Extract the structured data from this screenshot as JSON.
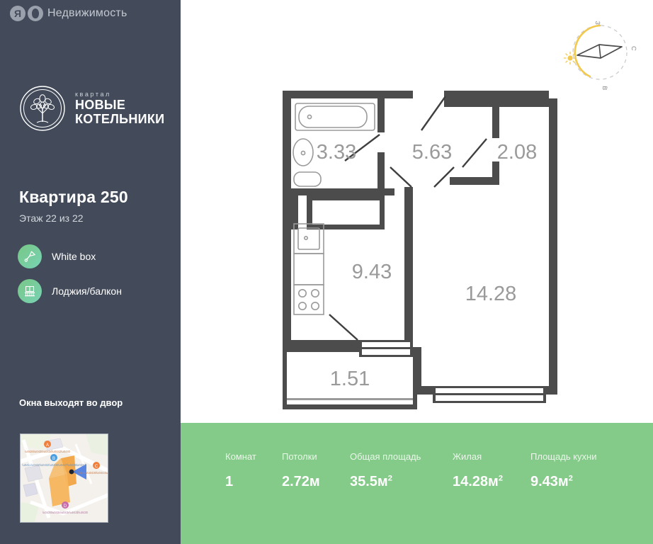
{
  "sidebar": {
    "brand": {
      "logo_letter": "Я",
      "logo_icon": "yandex-circle-icon",
      "text": "Недвижимость"
    },
    "developer": {
      "icon": "tree-emblem-icon",
      "small_line": "квартал",
      "line1": "НОВЫЕ",
      "line2": "КОТЕЛЬНИКИ"
    },
    "apartment": {
      "title": "Квартира 250",
      "floor": "Этаж 22 из 22"
    },
    "features": [
      {
        "icon": "paint-trowel-icon",
        "label": "White box"
      },
      {
        "icon": "balcony-icon",
        "label": "Лоджия/балкон"
      }
    ],
    "windows_note": "Окна выходят во двор",
    "map": {
      "icon": "map-thumbnail",
      "alt": "Карта расположения"
    },
    "colors": {
      "background": "#434b5a",
      "accent_green_start": "#77c785",
      "accent_green_end": "#79d3b5"
    }
  },
  "compass": {
    "icon": "compass-rose-icon",
    "sun_icon": "sun-icon",
    "labels": {
      "west": "З",
      "south": "С",
      "east": "В"
    },
    "arc_color": "#f2c94c"
  },
  "floorplan": {
    "icon": "floor-plan",
    "wall_color": "#4c4c4c",
    "label_color": "#9a9a9a",
    "rooms": [
      {
        "name": "bathroom",
        "area": "3.33"
      },
      {
        "name": "hallway",
        "area": "5.63"
      },
      {
        "name": "storage",
        "area": "2.08"
      },
      {
        "name": "kitchen",
        "area": "9.43"
      },
      {
        "name": "living-room",
        "area": "14.28"
      },
      {
        "name": "balcony",
        "area": "1.51"
      }
    ],
    "fixtures": [
      "bathtub-icon",
      "sink-icon",
      "toilet-icon",
      "kitchen-sink-icon",
      "stove-icon",
      "window-icon"
    ]
  },
  "stats": {
    "background": "#84ca88",
    "items": [
      {
        "label": "Комнат",
        "value": "1",
        "unit": ""
      },
      {
        "label": "Потолки",
        "value": "2.72м",
        "unit": ""
      },
      {
        "label": "Общая площадь",
        "value": "35.5м",
        "unit": "2"
      },
      {
        "label": "Жилая",
        "value": "14.28м",
        "unit": "2"
      },
      {
        "label": "Площадь кухни",
        "value": "9.43м",
        "unit": "2"
      }
    ]
  }
}
